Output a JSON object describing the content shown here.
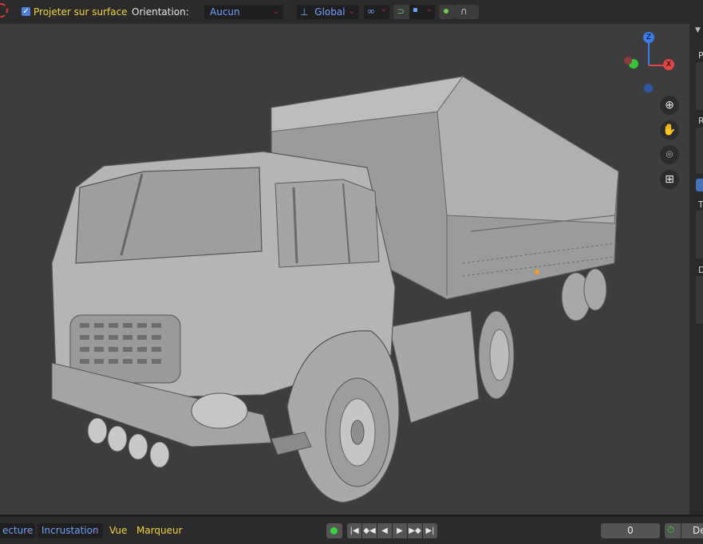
{
  "header": {
    "snap_checkbox_label": "Projeter sur surface",
    "orientation_label": "Orientation:",
    "orientation_value": "Aucun",
    "transform_space_value": "Global"
  },
  "sidebar_tabs": [
    "P",
    "R",
    "T",
    "D"
  ],
  "navigation": {
    "zoom_icon": "zoom-icon",
    "pan_icon": "hand-icon",
    "camera_icon": "camera-icon",
    "ortho_icon": "grid-icon"
  },
  "gizmo": {
    "z_label": "Z",
    "x_label": "X"
  },
  "timeline": {
    "menu_playback": "ecture",
    "menu_keying": "Incrustation",
    "menu_view": "Vue",
    "menu_marker": "Marqueur",
    "current_frame": "0",
    "start_label": "De"
  },
  "colors": {
    "accent_blue": "#6da1ff",
    "label_yellow": "#f2d53c",
    "axis_x": "#e04444",
    "axis_y": "#35c43a",
    "axis_z": "#3b7bea"
  }
}
